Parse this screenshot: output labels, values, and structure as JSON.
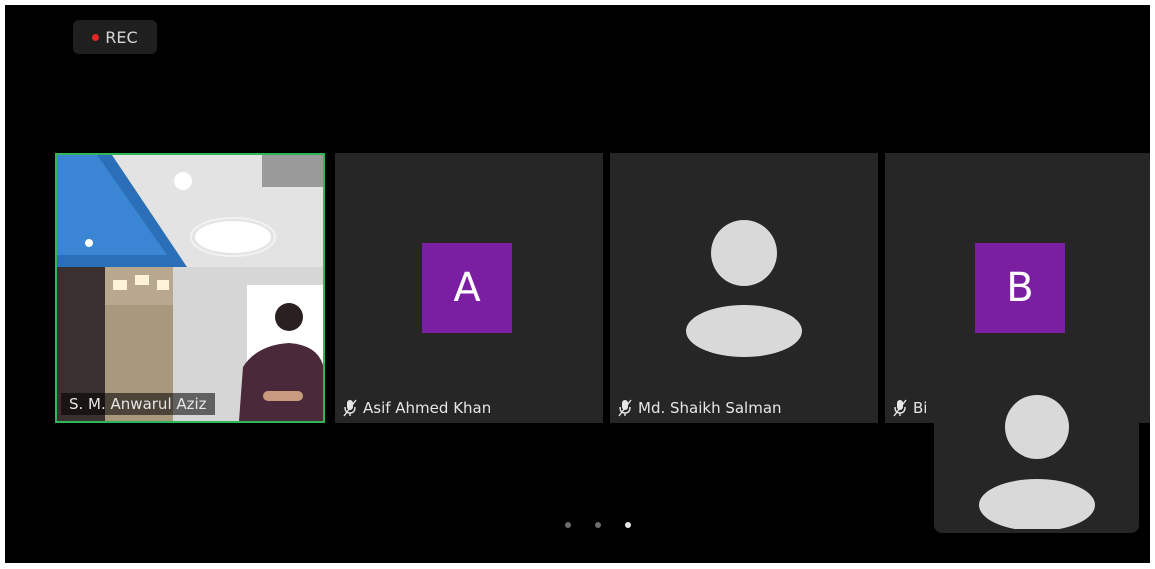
{
  "recording": {
    "label": "REC",
    "dot_color": "#e02828"
  },
  "participants": [
    {
      "name": "S. M. Anwarul Aziz",
      "type": "video",
      "speaking": true
    },
    {
      "name": "Asif Ahmed Khan",
      "type": "letter",
      "letter": "A",
      "muted": true
    },
    {
      "name": "Md. Shaikh Salman",
      "type": "silhouette",
      "muted": true
    },
    {
      "name": "Bi",
      "type": "letter",
      "letter": "B",
      "muted": true
    }
  ],
  "self_view": {
    "type": "silhouette"
  },
  "pagination": {
    "pages": 3,
    "current": 3
  },
  "colors": {
    "background": "#000000",
    "tile": "#262626",
    "active_speaker_border": "#2fb85a",
    "avatar_letter_bg": "#7b1fa2",
    "silhouette": "#d9d9d9"
  }
}
